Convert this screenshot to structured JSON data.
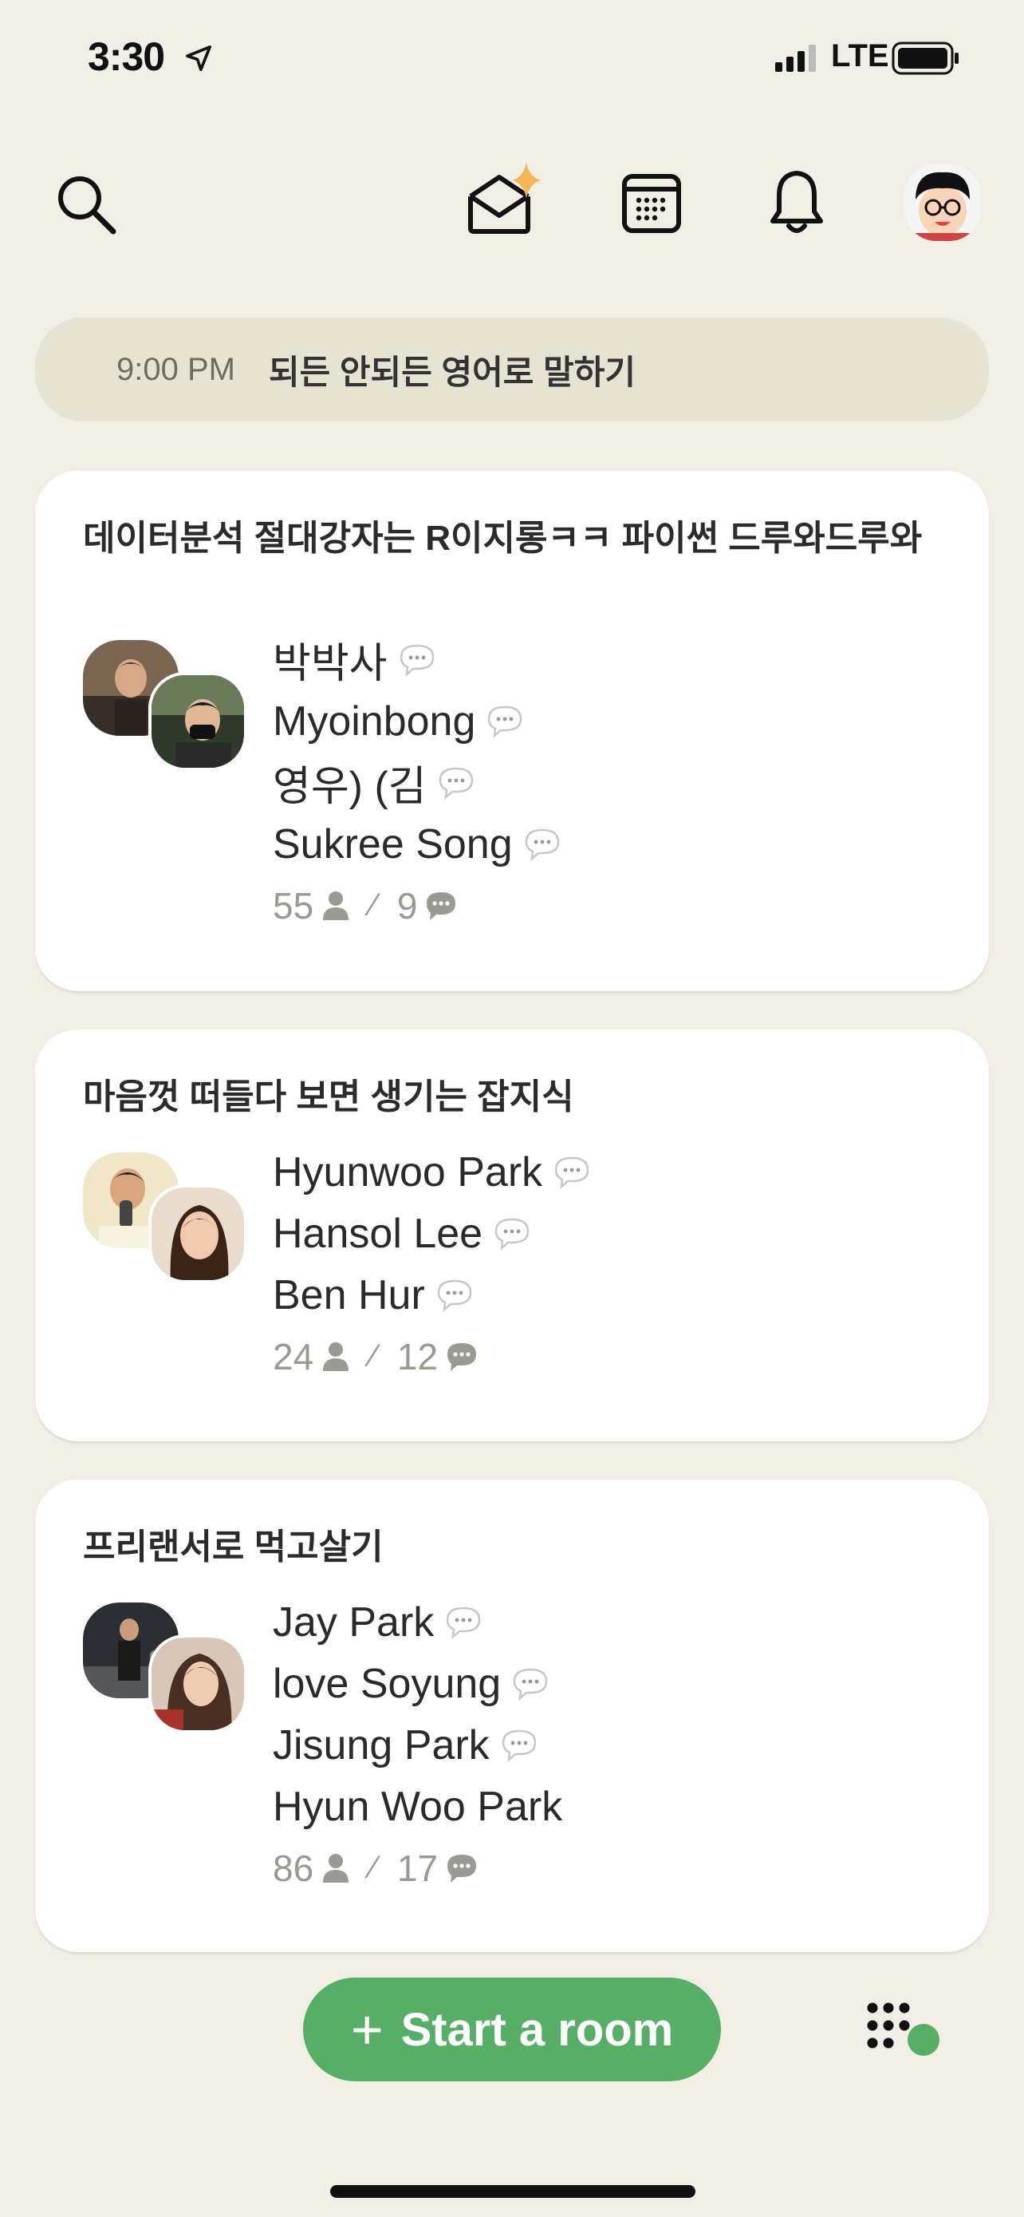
{
  "status_bar": {
    "time": "3:30",
    "network": "LTE"
  },
  "header": {
    "icons": [
      "search-icon",
      "envelope-sparkle-icon",
      "calendar-icon",
      "bell-icon",
      "profile-avatar"
    ]
  },
  "upcoming": {
    "time": "9:00 PM",
    "title": "되든 안되든 영어로 말하기"
  },
  "rooms": [
    {
      "title": "데이터분석 절대강자는 R이지롱ㅋㅋ 파이썬 드루와드루와",
      "speakers": [
        "박박사",
        "Myoinbong",
        "영우) (김",
        "Sukree Song"
      ],
      "listeners": "55",
      "speakers_count": "9"
    },
    {
      "title": "마음껏 떠들다 보면 생기는 잡지식",
      "speakers": [
        "Hyunwoo Park",
        "Hansol Lee",
        "Ben Hur"
      ],
      "listeners": "24",
      "speakers_count": "12"
    },
    {
      "title": "프리랜서로 먹고살기",
      "speakers": [
        "Jay Park",
        "love Soyung",
        "Jisung Park",
        "Hyun Woo Park"
      ],
      "listeners": "86",
      "speakers_count": "17"
    }
  ],
  "actions": {
    "start_room_label": "Start a room",
    "start_room_plus": "+"
  },
  "colors": {
    "background": "#f1efe5",
    "accent_green": "#57ae66",
    "banner": "#e6e3d3",
    "muted_text": "#9a9a93"
  }
}
